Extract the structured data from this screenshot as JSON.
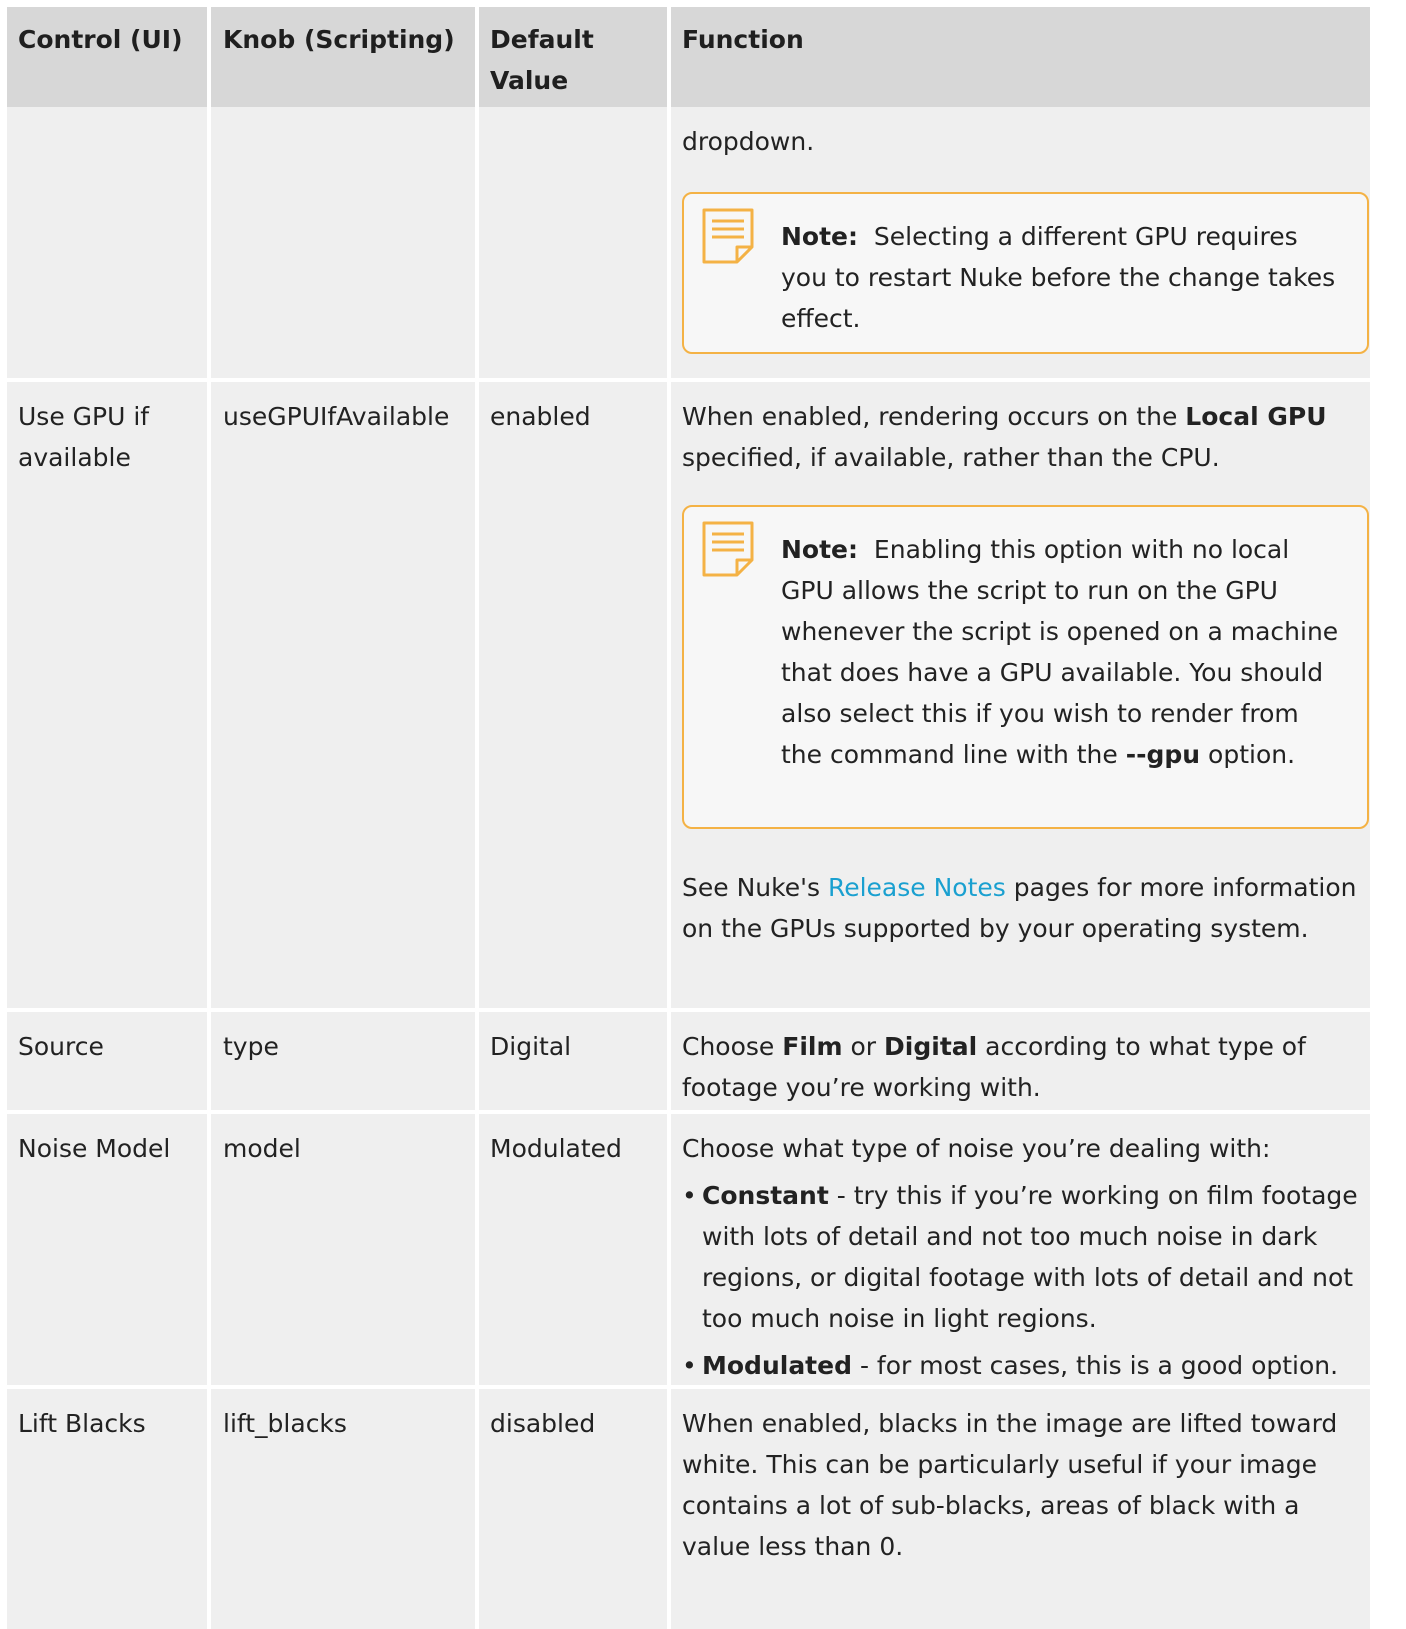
{
  "table": {
    "headers": [
      "Control (UI)",
      "Knob (Scripting)",
      "Default Value",
      "Function"
    ],
    "row0": {
      "function_text": "dropdown.",
      "note_label": "Note:",
      "note_text": "Selecting a different GPU requires you to restart Nuke before the change takes effect."
    },
    "row1": {
      "control": "Use GPU if available",
      "knob": "useGPUIfAvailable",
      "default": "enabled",
      "f1": "When enabled, rendering occurs on the",
      "f1_bold": "Local GPU",
      "f1_end": "specified, if available, rather than the CPU.",
      "note_label": "Note:",
      "note_text": "Enabling this option with no local GPU allows the script to run on the GPU whenever the script is opened on a machine that does have a GPU available. You should also select this if you wish to render from the command line with the",
      "note_bold": "--gpu",
      "note_end": "option.",
      "see_pre": "See Nuke's",
      "see_link": "Release Notes",
      "see_post": "pages for more information on the GPUs supported by your operating system."
    },
    "row2": {
      "control": "Source",
      "knob": "type",
      "default": "Digital",
      "pre": "Choose",
      "b1": "Film",
      "mid": "or",
      "b2": "Digital",
      "post": "according to what type of footage you’re working with."
    },
    "row3": {
      "control": "Noise Model",
      "knob": "model",
      "default": "Modulated",
      "intro": "Choose what type of noise you’re dealing with:",
      "bullet1_bold": "Constant",
      "bullet1_text": "- try this if you’re working on film footage with lots of detail and not too much noise in dark regions, or digital footage with lots of detail and not too much noise in light regions.",
      "bullet2_bold": "Modulated",
      "bullet2_text": "- for most cases, this is a good option."
    },
    "row4": {
      "control": "Lift Blacks",
      "knob": "lift_blacks",
      "default": "disabled",
      "text": "When enabled, blacks in the image are lifted toward white. This can be particularly useful if your image contains a lot of sub-blacks, areas of black with a value less than 0."
    }
  },
  "colors": {
    "header_bg": "#d7d7d7",
    "row_bg": "#efefef",
    "note_border": "#f4b245",
    "link": "#1aa0d0"
  },
  "icons": {
    "note": "note-document-icon"
  }
}
